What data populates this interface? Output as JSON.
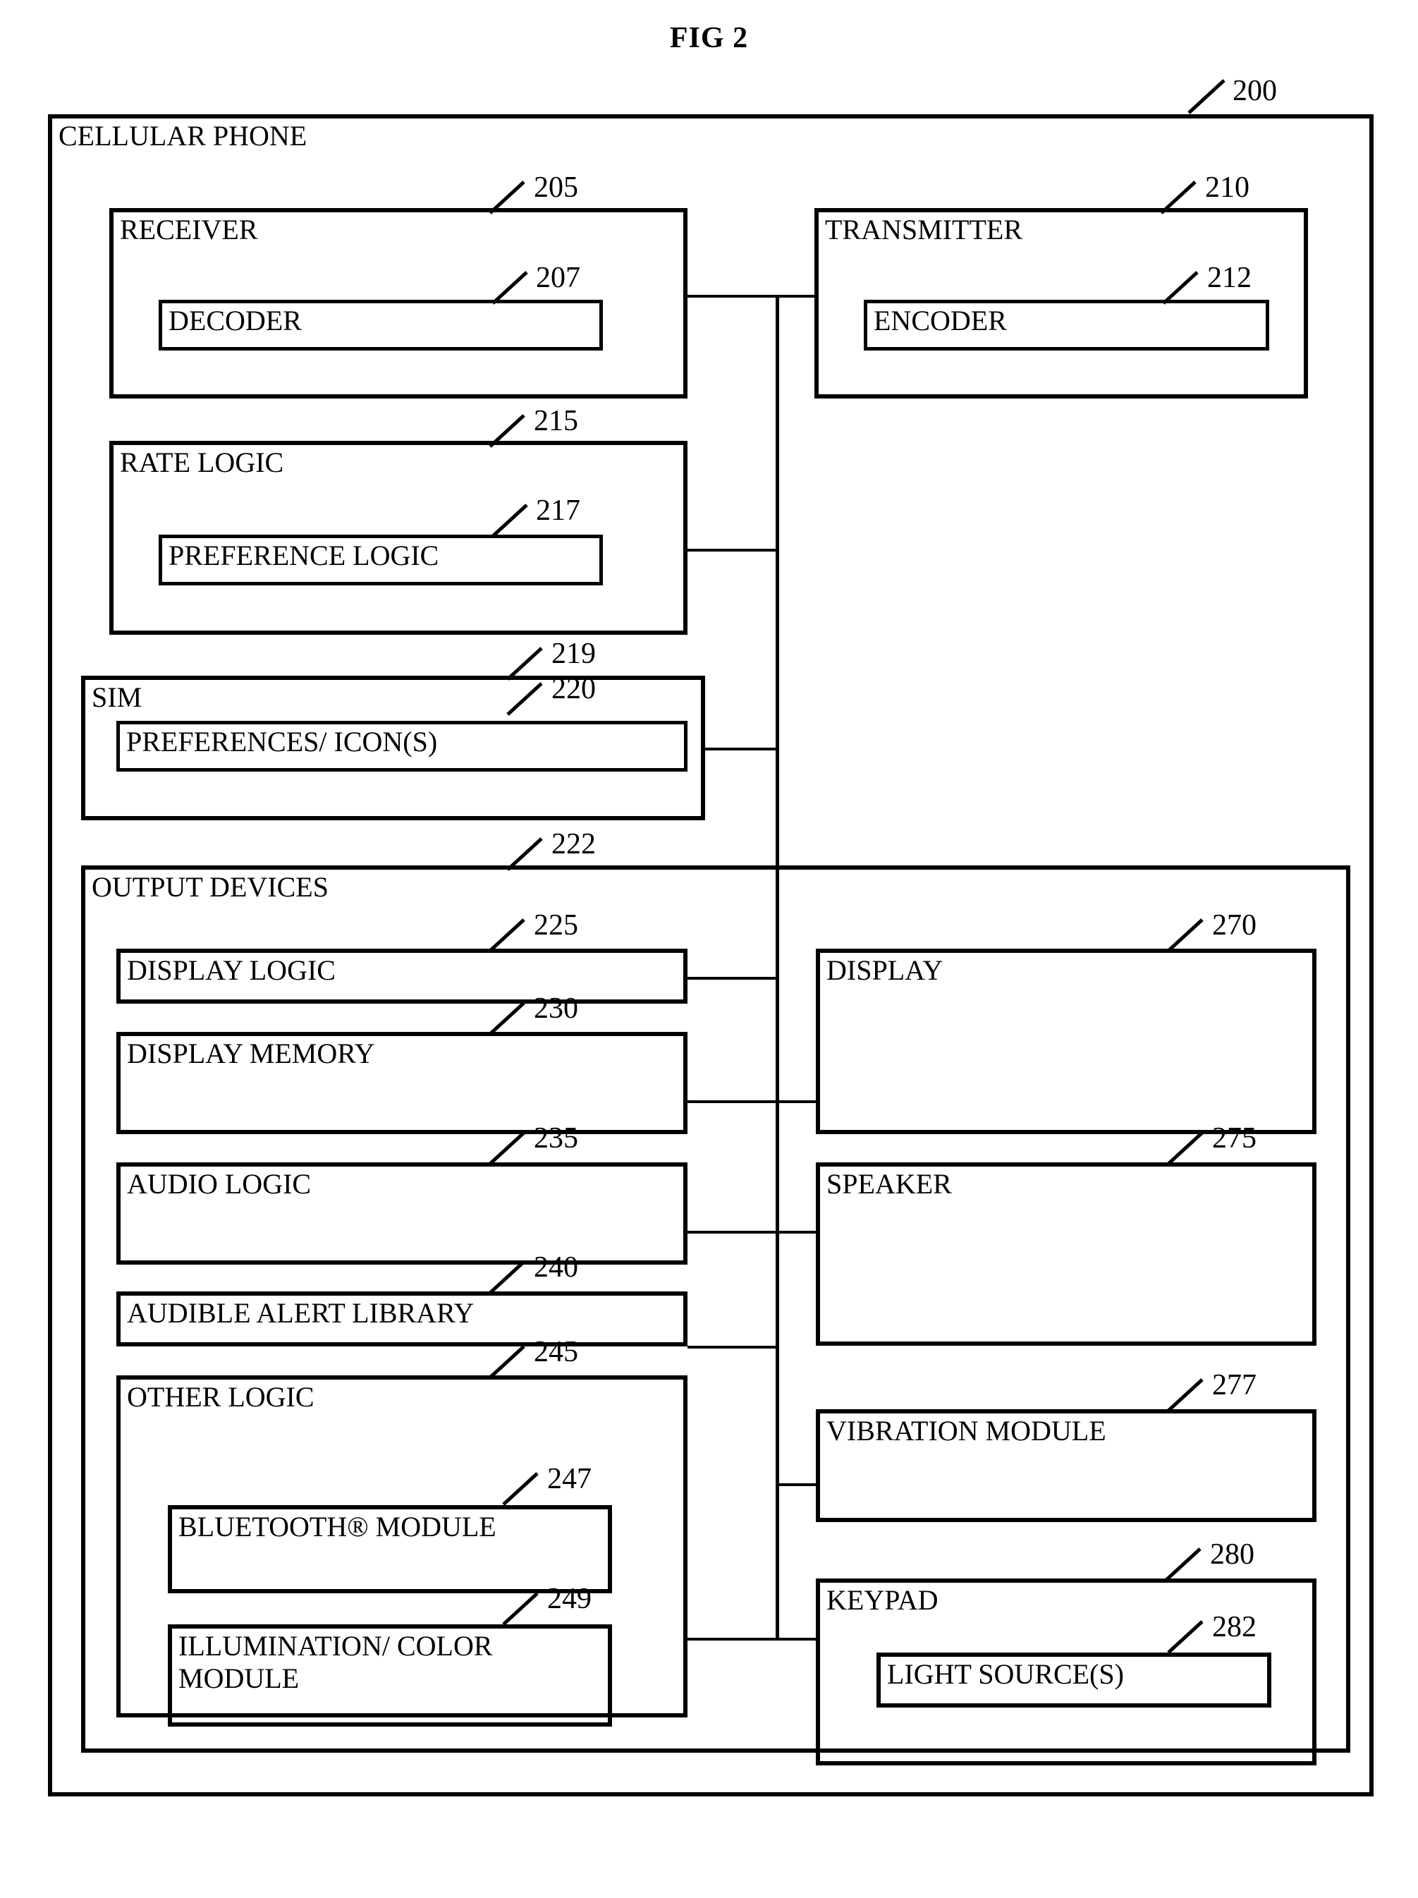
{
  "figure": {
    "title": "FIG 2",
    "root_label": "CELLULAR PHONE",
    "root_ref": "200"
  },
  "blocks": [
    {
      "id": "receiver",
      "label": "RECEIVER",
      "ref": "205"
    },
    {
      "id": "decoder",
      "label": "DECODER",
      "ref": "207"
    },
    {
      "id": "transmitter",
      "label": "TRANSMITTER",
      "ref": "210"
    },
    {
      "id": "encoder",
      "label": "ENCODER",
      "ref": "212"
    },
    {
      "id": "rate_logic",
      "label": "RATE LOGIC",
      "ref": "215"
    },
    {
      "id": "preference_logic",
      "label": "PREFERENCE LOGIC",
      "ref": "217"
    },
    {
      "id": "sim",
      "label": "SIM",
      "ref": "219"
    },
    {
      "id": "preferences_icons",
      "label": "PREFERENCES/  ICON(S)",
      "ref": "220"
    },
    {
      "id": "output_devices",
      "label": "OUTPUT DEVICES",
      "ref": "222"
    },
    {
      "id": "display_logic",
      "label": "DISPLAY LOGIC",
      "ref": "225"
    },
    {
      "id": "display_memory",
      "label": "DISPLAY MEMORY",
      "ref": "230"
    },
    {
      "id": "audio_logic",
      "label": "AUDIO LOGIC",
      "ref": "235"
    },
    {
      "id": "audible_alert",
      "label": "AUDIBLE ALERT LIBRARY",
      "ref": "240"
    },
    {
      "id": "other_logic",
      "label": "OTHER LOGIC",
      "ref": "245"
    },
    {
      "id": "bluetooth",
      "label": "BLUETOOTH® MODULE",
      "ref": "247"
    },
    {
      "id": "illumination",
      "label": "ILLUMINATION/ COLOR MODULE",
      "ref": "249"
    },
    {
      "id": "display",
      "label": "DISPLAY",
      "ref": "270"
    },
    {
      "id": "speaker",
      "label": "SPEAKER",
      "ref": "275"
    },
    {
      "id": "vibration",
      "label": "VIBRATION MODULE",
      "ref": "277"
    },
    {
      "id": "keypad",
      "label": "KEYPAD",
      "ref": "280"
    },
    {
      "id": "light_sources",
      "label": "LIGHT SOURCE(S)",
      "ref": "282"
    }
  ],
  "colors": {
    "stroke": "#000000",
    "background": "#ffffff"
  }
}
